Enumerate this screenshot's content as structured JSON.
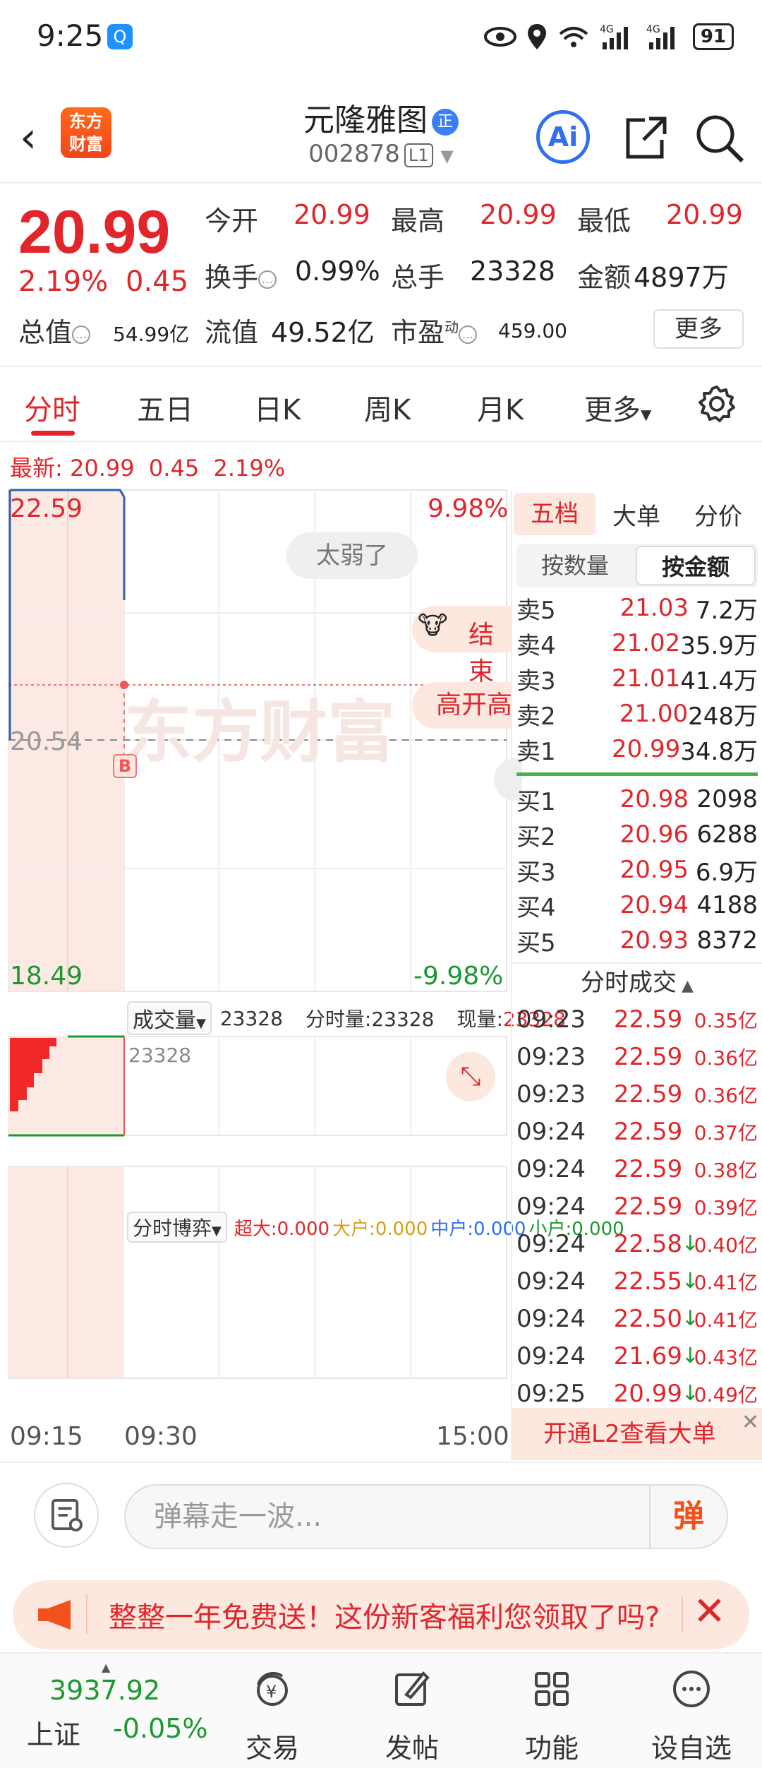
{
  "status_bar": {
    "time": "9:25",
    "battery": "91"
  },
  "header": {
    "back_icon": "back-arrow-icon",
    "app_logo": "东方\n财富",
    "stock_name": "元隆雅图",
    "zheng_badge": "正",
    "stock_code": "002878",
    "level_badge": "L1",
    "ai_label": "Ai"
  },
  "quote": {
    "price": "20.99",
    "change_pct": "2.19%",
    "change_amt": "0.45",
    "open_label": "今开",
    "open_val": "20.99",
    "high_label": "最高",
    "high_val": "20.99",
    "low_label": "最低",
    "low_val": "20.99",
    "turnover_label": "换手",
    "turnover_val": "0.99%",
    "volume_label": "总手",
    "volume_val": "23328",
    "amount_label": "金额",
    "amount_val": "4897万",
    "mktcap_label": "总值",
    "mktcap_val": "54.99亿",
    "float_label": "流值",
    "float_val": "49.52亿",
    "pe_label": "市盈",
    "pe_super": "动",
    "pe_val": "459.00",
    "more_label": "更多"
  },
  "tabs": {
    "items": [
      "分时",
      "五日",
      "日K",
      "周K",
      "月K",
      "更多"
    ],
    "active": "分时"
  },
  "latest": {
    "label": "最新:",
    "price": "20.99",
    "chg": "0.45",
    "pct": "2.19%"
  },
  "chart": {
    "y_top": "22.59",
    "y_mid": "20.54",
    "y_bottom": "18.49",
    "pct_top": "9.98%",
    "pct_bottom": "-9.98%",
    "weak_bubble": "太弱了",
    "end_tag": "结束",
    "high_open_tag": "高开高",
    "watermark": "东方财富",
    "b_marker": "B",
    "volume_selector": "成交量",
    "volume_total": "23328",
    "volume_tick_label": "分时量:23328",
    "volume_now_label": "现量:",
    "volume_now_val": "23328",
    "volume_axis_label": "23328",
    "game_selector": "分时博弈",
    "game_super": "超大:0.000",
    "game_big": "大户:0.000",
    "game_mid": "中户:0.000",
    "game_small": "小户:0.000",
    "time_start": "09:15",
    "time_mid": "09:30",
    "time_end": "15:00"
  },
  "order_book": {
    "tabs": [
      "五档",
      "大单",
      "分价"
    ],
    "active_tab": "五档",
    "mode_tabs": [
      "按数量",
      "按金额"
    ],
    "active_mode": "按金额",
    "asks": [
      {
        "label": "卖5",
        "price": "21.03",
        "vol": "7.2万"
      },
      {
        "label": "卖4",
        "price": "21.02",
        "vol": "35.9万"
      },
      {
        "label": "卖3",
        "price": "21.01",
        "vol": "41.4万"
      },
      {
        "label": "卖2",
        "price": "21.00",
        "vol": "248万"
      },
      {
        "label": "卖1",
        "price": "20.99",
        "vol": "34.8万"
      }
    ],
    "bids": [
      {
        "label": "买1",
        "price": "20.98",
        "vol": "2098"
      },
      {
        "label": "买2",
        "price": "20.96",
        "vol": "6288"
      },
      {
        "label": "买3",
        "price": "20.95",
        "vol": "6.9万"
      },
      {
        "label": "买4",
        "price": "20.94",
        "vol": "4188"
      },
      {
        "label": "买5",
        "price": "20.93",
        "vol": "8372"
      }
    ],
    "trades_title": "分时成交",
    "trades": [
      {
        "time": "09:23",
        "price": "22.59",
        "arrow": "",
        "amt": "0.35亿"
      },
      {
        "time": "09:23",
        "price": "22.59",
        "arrow": "",
        "amt": "0.36亿"
      },
      {
        "time": "09:23",
        "price": "22.59",
        "arrow": "",
        "amt": "0.36亿"
      },
      {
        "time": "09:24",
        "price": "22.59",
        "arrow": "",
        "amt": "0.37亿"
      },
      {
        "time": "09:24",
        "price": "22.59",
        "arrow": "",
        "amt": "0.38亿"
      },
      {
        "time": "09:24",
        "price": "22.59",
        "arrow": "",
        "amt": "0.39亿"
      },
      {
        "time": "09:24",
        "price": "22.58",
        "arrow": "↓",
        "amt": "0.40亿"
      },
      {
        "time": "09:24",
        "price": "22.55",
        "arrow": "↓",
        "amt": "0.41亿"
      },
      {
        "time": "09:24",
        "price": "22.50",
        "arrow": "↓",
        "amt": "0.41亿"
      },
      {
        "time": "09:24",
        "price": "21.69",
        "arrow": "↓",
        "amt": "0.43亿"
      },
      {
        "time": "09:25",
        "price": "20.99",
        "arrow": "↓",
        "amt": "0.49亿"
      }
    ],
    "l2_banner": "开通L2查看大单"
  },
  "comment": {
    "placeholder": "弹幕走一波...",
    "danmu": "弹"
  },
  "promo": {
    "text": "整整一年免费送！这份新客福利您领取了吗?"
  },
  "bottom_nav": {
    "index_val": "3937.92",
    "index_name": "上证",
    "index_chg": "-0.05%",
    "items": [
      {
        "label": "交易",
        "icon": "trade-icon"
      },
      {
        "label": "发帖",
        "icon": "post-icon"
      },
      {
        "label": "功能",
        "icon": "functions-icon"
      },
      {
        "label": "设自选",
        "icon": "watchlist-icon"
      }
    ]
  },
  "colors": {
    "up": "#e0262b",
    "down": "#1a9a2e",
    "accent_blue": "#2f6ff0",
    "brand_orange": "#f2511b"
  }
}
